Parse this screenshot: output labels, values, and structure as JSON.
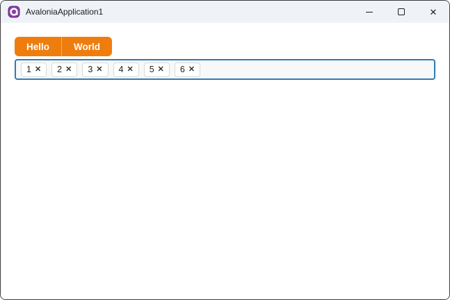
{
  "window": {
    "title": "AvaloniaApplication1",
    "app_icon": "avalonia-logo",
    "controls": {
      "close_glyph": "✕"
    }
  },
  "tabs": {
    "items": [
      {
        "label": "Hello"
      },
      {
        "label": "World"
      }
    ]
  },
  "chip_input": {
    "close_glyph": "✕",
    "chips": [
      {
        "label": "1"
      },
      {
        "label": "2"
      },
      {
        "label": "3"
      },
      {
        "label": "4"
      },
      {
        "label": "5"
      },
      {
        "label": "6"
      }
    ]
  },
  "colors": {
    "accent_orange": "#EF7D0D",
    "focus_border_blue": "#2F7BAF",
    "titlebar_bg": "#EFF3F8",
    "logo_purple": "#8A3FA5"
  }
}
